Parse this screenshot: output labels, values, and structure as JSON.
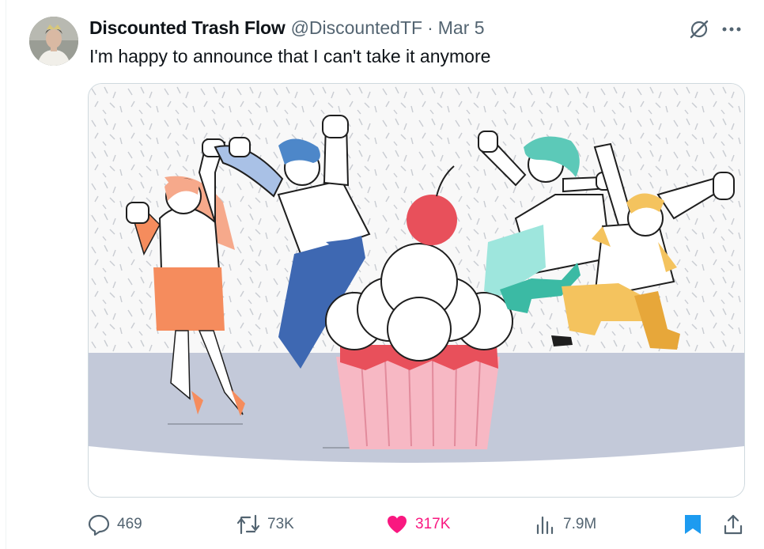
{
  "tweet": {
    "author_name": "Discounted Trash Flow",
    "handle": "@DiscountedTF",
    "separator": "·",
    "date": "Mar 5",
    "text": "I'm happy to announce that I can't take it anymore"
  },
  "actions": {
    "replies": "469",
    "reposts": "73K",
    "likes": "317K",
    "views": "7.9M",
    "liked": true,
    "bookmarked": true
  },
  "colors": {
    "like": "#f91880",
    "bookmark": "#1d9bf0",
    "muted": "#536471",
    "cherry": "#e8505b",
    "cup": "#f7b8c4"
  },
  "icons": [
    "grok-icon",
    "more-icon",
    "reply-icon",
    "repost-icon",
    "like-icon",
    "views-icon",
    "bookmark-icon",
    "share-icon"
  ]
}
